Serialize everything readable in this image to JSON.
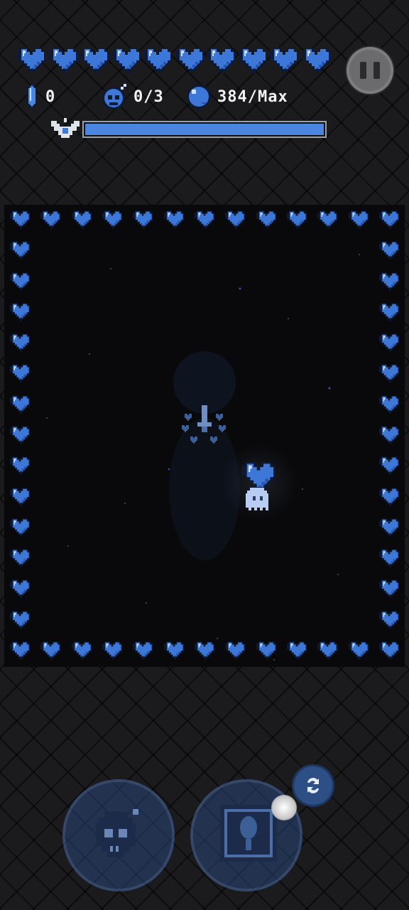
{
  "hud": {
    "hp": {
      "hearts_full": 10,
      "heart_color": "#3d78d8"
    },
    "stats": {
      "crystals": {
        "icon": "crystal-icon",
        "value": "0"
      },
      "bombs": {
        "icon": "skull-bomb-icon",
        "value": "0/3"
      },
      "mana": {
        "icon": "blue-orb-icon",
        "value": "384/Max"
      }
    },
    "level_bar": {
      "icon": "winged-emblem-icon",
      "progress": 1.0,
      "fill_color": "#4a86e0"
    },
    "pause": {
      "icon": "pause-icon"
    }
  },
  "arena": {
    "wall": {
      "icon": "heart-icon",
      "color": "#3d78d8"
    },
    "player": {
      "icon": "ghost-icon"
    },
    "held_item": {
      "icon": "heart-icon"
    },
    "enemy": {
      "icon": "sword-heart-cluster-icon"
    }
  },
  "controls": {
    "bomb_skill": {
      "icon": "skull-bomb-icon"
    },
    "item_skill": {
      "icon": "card-slot-icon"
    },
    "swap": {
      "icon": "swap-icon"
    }
  },
  "colors": {
    "accent": "#4a86e0",
    "background": "#1b1b1d",
    "arena": "#09090b"
  }
}
